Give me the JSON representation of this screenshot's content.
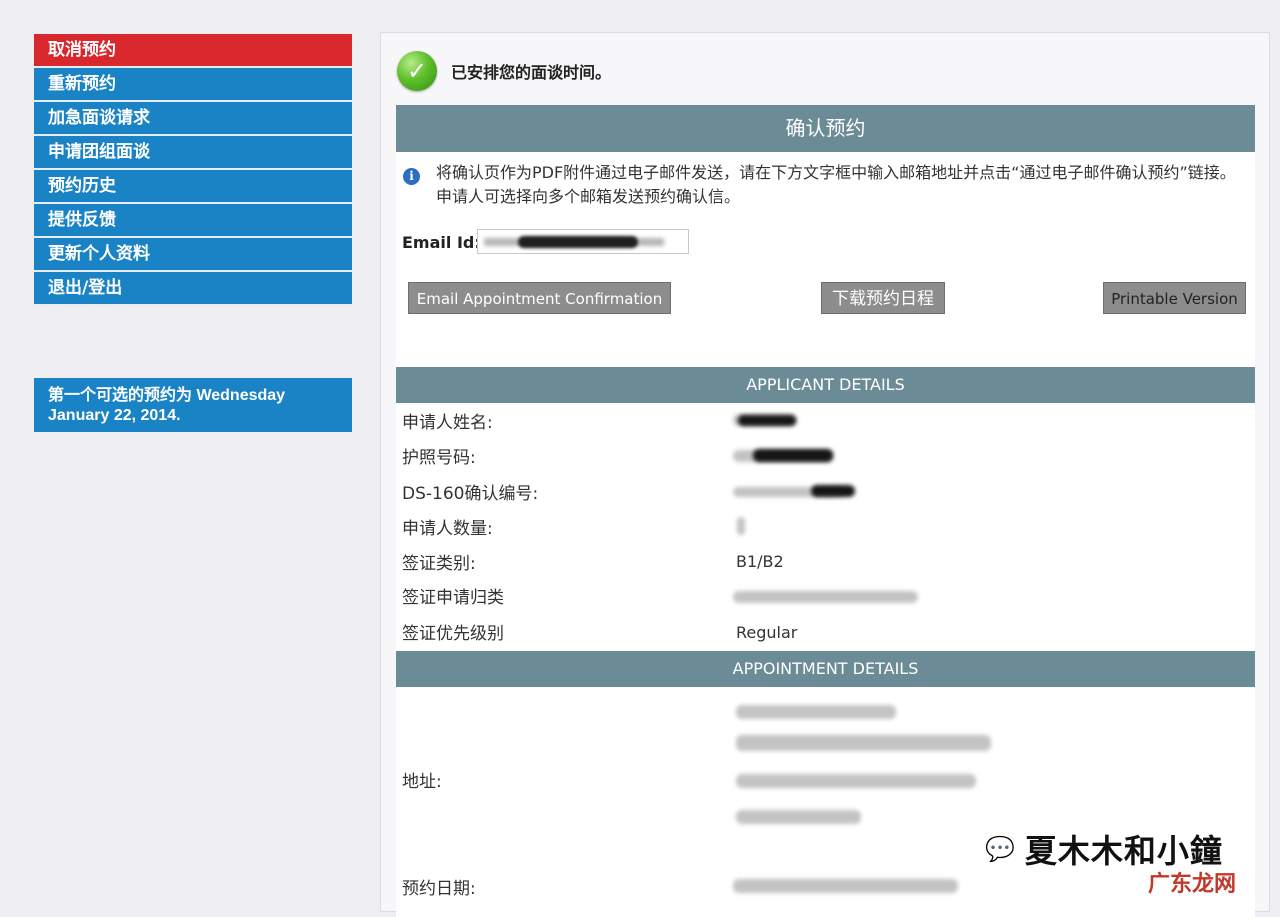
{
  "sidebar": {
    "items": [
      {
        "label": "取消预约"
      },
      {
        "label": "重新预约"
      },
      {
        "label": "加急面谈请求"
      },
      {
        "label": "申请团组面谈"
      },
      {
        "label": "预约历史"
      },
      {
        "label": "提供反馈"
      },
      {
        "label": "更新个人资料"
      },
      {
        "label": "退出/登出"
      }
    ],
    "info_box": "第一个可选的预约为 Wednesday January 22, 2014."
  },
  "success_message": "已安排您的面谈时间。",
  "confirm": {
    "header": "确认预约",
    "notice": "将确认页作为PDF附件通过电子邮件发送，请在下方文字框中输入邮箱地址并点击“通过电子邮件确认预约”链接。申请人可选择向多个邮箱发送预约确认信。",
    "email_label": "Email Id:",
    "email_btn": "Email Appointment Confirmation",
    "download_btn": "下载预约日程",
    "print_btn": "Printable Version"
  },
  "applicant": {
    "header": "APPLICANT DETAILS",
    "rows": [
      {
        "label": "申请人姓名:",
        "value": ""
      },
      {
        "label": "护照号码:",
        "value": ""
      },
      {
        "label": "DS-160确认编号:",
        "value": ""
      },
      {
        "label": "申请人数量:",
        "value": ""
      },
      {
        "label": "签证类别:",
        "value": "B1/B2"
      },
      {
        "label": "签证申请归类",
        "value": ""
      },
      {
        "label": "签证优先级别",
        "value": "Regular"
      }
    ]
  },
  "appointment": {
    "header": "APPOINTMENT DETAILS",
    "address_label": "地址:",
    "date_label": "预约日期:"
  },
  "watermark": {
    "text": "夏木木和小鐘",
    "sub": "广东龙网"
  }
}
